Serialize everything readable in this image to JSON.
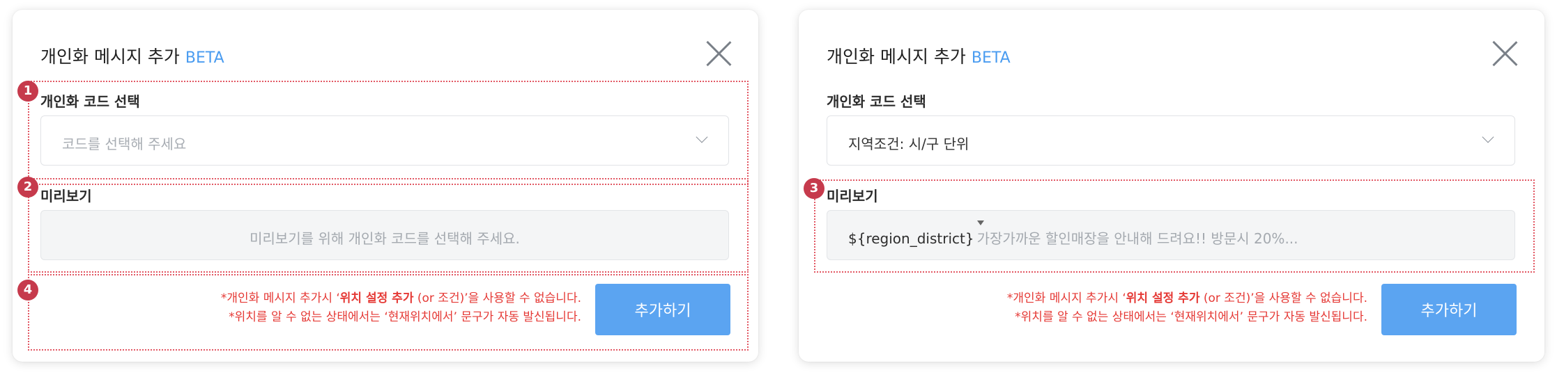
{
  "left_panel": {
    "title": "개인화 메시지 추가",
    "beta": "BETA",
    "code_label": "개인화 코드 선택",
    "select_placeholder": "코드를 선택해 주세요",
    "preview_label": "미리보기",
    "preview_empty": "미리보기를 위해 개인화 코드를 선택해 주세요.",
    "note1_pre": "*개인화 메시지 추가시 ‘",
    "note1_bold": "위치 설정 추가",
    "note1_post": " (or 조건)’을 사용할 수 없습니다.",
    "note2": "*위치를 알 수 없는 상태에서는 ‘현재위치에서’ 문구가 자동 발신됩니다.",
    "add_button": "추가하기",
    "badges": [
      "1",
      "2",
      "4"
    ]
  },
  "right_panel": {
    "title": "개인화 메시지 추가",
    "beta": "BETA",
    "code_label": "개인화 코드 선택",
    "select_value": "지역조건: 시/구 단위",
    "preview_label": "미리보기",
    "preview_code": "${region_district}",
    "preview_text": "가장가까운 할인매장을 안내해 드려요!! 방문시 20%...",
    "note1_pre": "*개인화 메시지 추가시 ‘",
    "note1_bold": "위치 설정 추가",
    "note1_post": " (or 조건)’을 사용할 수 없습니다.",
    "note2": "*위치를 알 수 없는 상태에서는 ‘현재위치에서’ 문구가 자동 발신됩니다.",
    "add_button": "추가하기",
    "badges": [
      "3"
    ]
  },
  "colors": {
    "accent": "#5ba4f1",
    "beta": "#4a9cf0",
    "warning": "#e53935",
    "annotation": "#e25763",
    "badge": "#c63a4c"
  },
  "icons": [
    "close-icon",
    "chevron-down-icon"
  ]
}
